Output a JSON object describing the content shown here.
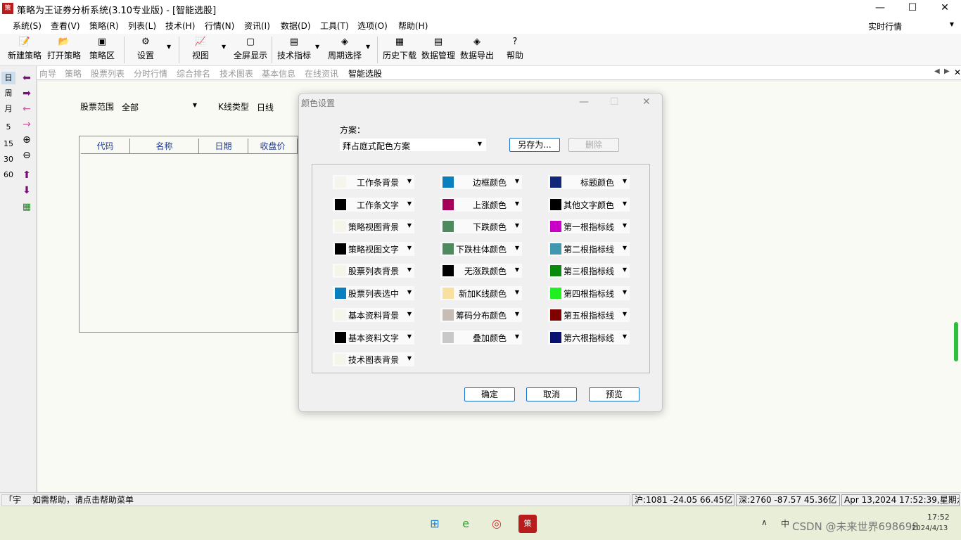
{
  "window": {
    "title": "策略为王证券分析系统(3.10专业版) - [智能选股]",
    "icon": "app-logo-icon",
    "min": "—",
    "max": "☐",
    "close": "✕"
  },
  "menu": [
    "系统(S)",
    "查看(V)",
    "策略(R)",
    "列表(L)",
    "技术(H)",
    "行情(N)",
    "资讯(I)",
    "数据(D)",
    "工具(T)",
    "选项(O)",
    "帮助(H)"
  ],
  "quote_mode": "实时行情",
  "toolbar": [
    "新建策略",
    "打开策略",
    "策略区",
    "设置",
    "视图",
    "全屏显示",
    "技术指标",
    "周期选择",
    "历史下载",
    "数据管理",
    "数据导出",
    "帮助"
  ],
  "tabs": [
    "向导",
    "策略",
    "股票列表",
    "分时行情",
    "综合排名",
    "技术图表",
    "基本信息",
    "在线资讯",
    "智能选股"
  ],
  "left_icons": [
    "日",
    "周",
    "月",
    "5",
    "15",
    "30",
    "60"
  ],
  "main": {
    "range_label": "股票范围",
    "range_value": "全部",
    "kline_label": "K线类型",
    "kline_value": "日线",
    "columns": [
      "代码",
      "名称",
      "日期",
      "收盘价"
    ]
  },
  "dialog": {
    "title": "颜色设置",
    "scheme_label": "方案：",
    "scheme_value": "拜占庭式配色方案",
    "save_as": "另存为...",
    "delete": "删除",
    "ok": "确定",
    "cancel": "取消",
    "preview": "预览",
    "colors": [
      {
        "label": "工作条背景",
        "color": "#f5f5ec"
      },
      {
        "label": "边框颜色",
        "color": "#0a7fc0"
      },
      {
        "label": "标题颜色",
        "color": "#13277a"
      },
      {
        "label": "工作条文字",
        "color": "#000000"
      },
      {
        "label": "上涨颜色",
        "color": "#a6005a"
      },
      {
        "label": "其他文字颜色",
        "color": "#000000"
      },
      {
        "label": "策略视图背景",
        "color": "#f5f5ec"
      },
      {
        "label": "下跌颜色",
        "color": "#4f8a5f"
      },
      {
        "label": "第一根指标线",
        "color": "#c800c8"
      },
      {
        "label": "策略视图文字",
        "color": "#000000"
      },
      {
        "label": "下跌柱体颜色",
        "color": "#4f8a5f"
      },
      {
        "label": "第二根指标线",
        "color": "#3f98b0"
      },
      {
        "label": "股票列表背景",
        "color": "#f5f5ec"
      },
      {
        "label": "无涨跌颜色",
        "color": "#000000"
      },
      {
        "label": "第三根指标线",
        "color": "#0a8a0a"
      },
      {
        "label": "股票列表选中",
        "color": "#0a7fc0"
      },
      {
        "label": "新加K线颜色",
        "color": "#f7e0a0"
      },
      {
        "label": "第四根指标线",
        "color": "#20f020"
      },
      {
        "label": "基本资料背景",
        "color": "#f5f5ec"
      },
      {
        "label": "筹码分布颜色",
        "color": "#c8bdb5"
      },
      {
        "label": "第五根指标线",
        "color": "#800000"
      },
      {
        "label": "基本资料文字",
        "color": "#000000"
      },
      {
        "label": "叠加颜色",
        "color": "#c8c8c8"
      },
      {
        "label": "第六根指标线",
        "color": "#0a1070"
      },
      {
        "label": "技术图表背景",
        "color": "#f5f5ec"
      }
    ]
  },
  "status": {
    "help": "如需帮助，请点击帮助菜单",
    "sh": "沪:1081 -24.05 66.45亿",
    "sz": "深:2760 -87.57 45.36亿",
    "time": "Apr 13,2024 17:52:39,星期六"
  },
  "taskbar": {
    "clock": "17:52",
    "date": "2024/4/13",
    "watermark": "CSDN @未来世界698698",
    "ime": "中"
  }
}
